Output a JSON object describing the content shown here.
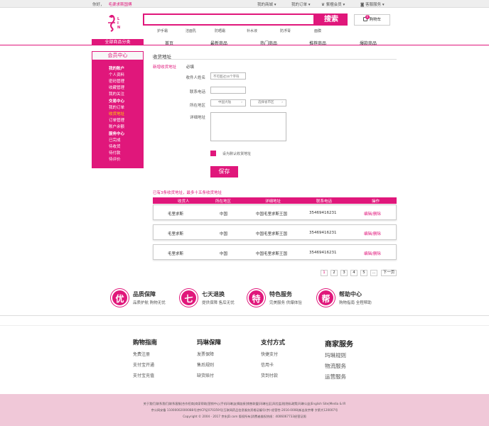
{
  "topbar": {
    "greeting": "你好，",
    "username": "毛渠求斯国傅",
    "links": [
      "我的商城",
      "我的订单",
      "紫檀会员",
      "客服服务"
    ]
  },
  "search": {
    "button": "搜索",
    "placeholder": ""
  },
  "cart": {
    "label": "购物车",
    "count": "0"
  },
  "hot_keywords": [
    "护手霜",
    "洁面乳",
    "防晒霜",
    "补水液",
    "防浮膏",
    "面膜"
  ],
  "nav": {
    "category": "全部商品分类",
    "items": [
      "首页",
      "最新商品",
      "热门商品",
      "推荐商品",
      "爆款商品"
    ]
  },
  "sidebar": {
    "title": "会员中心",
    "items": [
      {
        "label": "我的账户",
        "type": "head"
      },
      {
        "label": "个人资料",
        "type": "item"
      },
      {
        "label": "密码管理",
        "type": "item"
      },
      {
        "label": "收藏管理",
        "type": "item"
      },
      {
        "label": "我的关注",
        "type": "item"
      },
      {
        "label": "交易中心",
        "type": "head"
      },
      {
        "label": "我的订单",
        "type": "item"
      },
      {
        "label": "收货地址",
        "type": "current"
      },
      {
        "label": "订单管理",
        "type": "item"
      },
      {
        "label": "账户余额",
        "type": "item"
      },
      {
        "label": "服务中心",
        "type": "head"
      },
      {
        "label": "已完成",
        "type": "item"
      },
      {
        "label": "待收货",
        "type": "item"
      },
      {
        "label": "待付款",
        "type": "item"
      },
      {
        "label": "待评价",
        "type": "item"
      }
    ]
  },
  "page": {
    "title": "收货地址"
  },
  "form": {
    "new_addr": "新增收货地址",
    "required": "必填",
    "name_label": "收件人姓名",
    "name_placeholder": "不可超过15个字符",
    "phone_label": "联系电话",
    "region_label": "所在地区",
    "province": "中国大陆",
    "city": "选择省市区",
    "detail_label": "详细地址",
    "default_label": "设为默认收货地址",
    "save": "保存"
  },
  "saved_info": "已有3条收货地址，最多十五条收货地址",
  "table": {
    "headers": [
      "收货人",
      "所在地区",
      "详细地址",
      "联系电话",
      "操作"
    ],
    "rows": [
      [
        "毛里求斯",
        "中国",
        "中国毛里求斯王国",
        "35469416231",
        "编辑/删除"
      ],
      [
        "毛里求斯",
        "中国",
        "中国毛里求斯王国",
        "35469416231",
        "编辑/删除"
      ],
      [
        "毛里求斯",
        "中国",
        "中国毛里求斯王国",
        "35469416231",
        "编辑/删除"
      ]
    ]
  },
  "pager": {
    "pages": [
      "1",
      "2",
      "3",
      "4",
      "5",
      "..."
    ],
    "next": "下一页"
  },
  "guarantees": [
    {
      "icon": "优",
      "title": "品质保障",
      "sub": "品质护航  购物无忧"
    },
    {
      "icon": "七",
      "title": "七天退换",
      "sub": "提供保障  售后无忧"
    },
    {
      "icon": "特",
      "title": "特色服务",
      "sub": "完美服务  供爆体验"
    },
    {
      "icon": "帮",
      "title": "帮助中心",
      "sub": "购物指南  全程帮助"
    }
  ],
  "footer_cols": [
    {
      "title": "购物指南",
      "items": [
        "免费注册",
        "支付宝开通",
        "支付宝充值"
      ]
    },
    {
      "title": "玛琳保障",
      "items": [
        "发票保障",
        "售后规则",
        "缺货赔付"
      ]
    },
    {
      "title": "支付方式",
      "items": [
        "快捷支付",
        "信用卡",
        "货到付款"
      ]
    },
    {
      "title": "商家服务",
      "items": [
        "玛琳规则",
        "物流服务",
        "运营服务"
      ]
    }
  ],
  "bottom": {
    "line1": "关于我们|联系我们|联系客服|合作招商|商家帮助|营销中心|手机玛琳|友情链接|销售联盟|玛琳社区|风险监测|隐私政策|玛琳公益|English Site|Media & IR",
    "line2": "京公网安备 11000002000088号|京ICP证070359号|互联网药品信息服务资格证编号(京)-经营性-2016-0008|新出发京零 字第大120007号",
    "line3": "Copyright © 2004 - 2017  京东JD.com 版权所有|消费者维权热线：4006067733经营证照"
  }
}
